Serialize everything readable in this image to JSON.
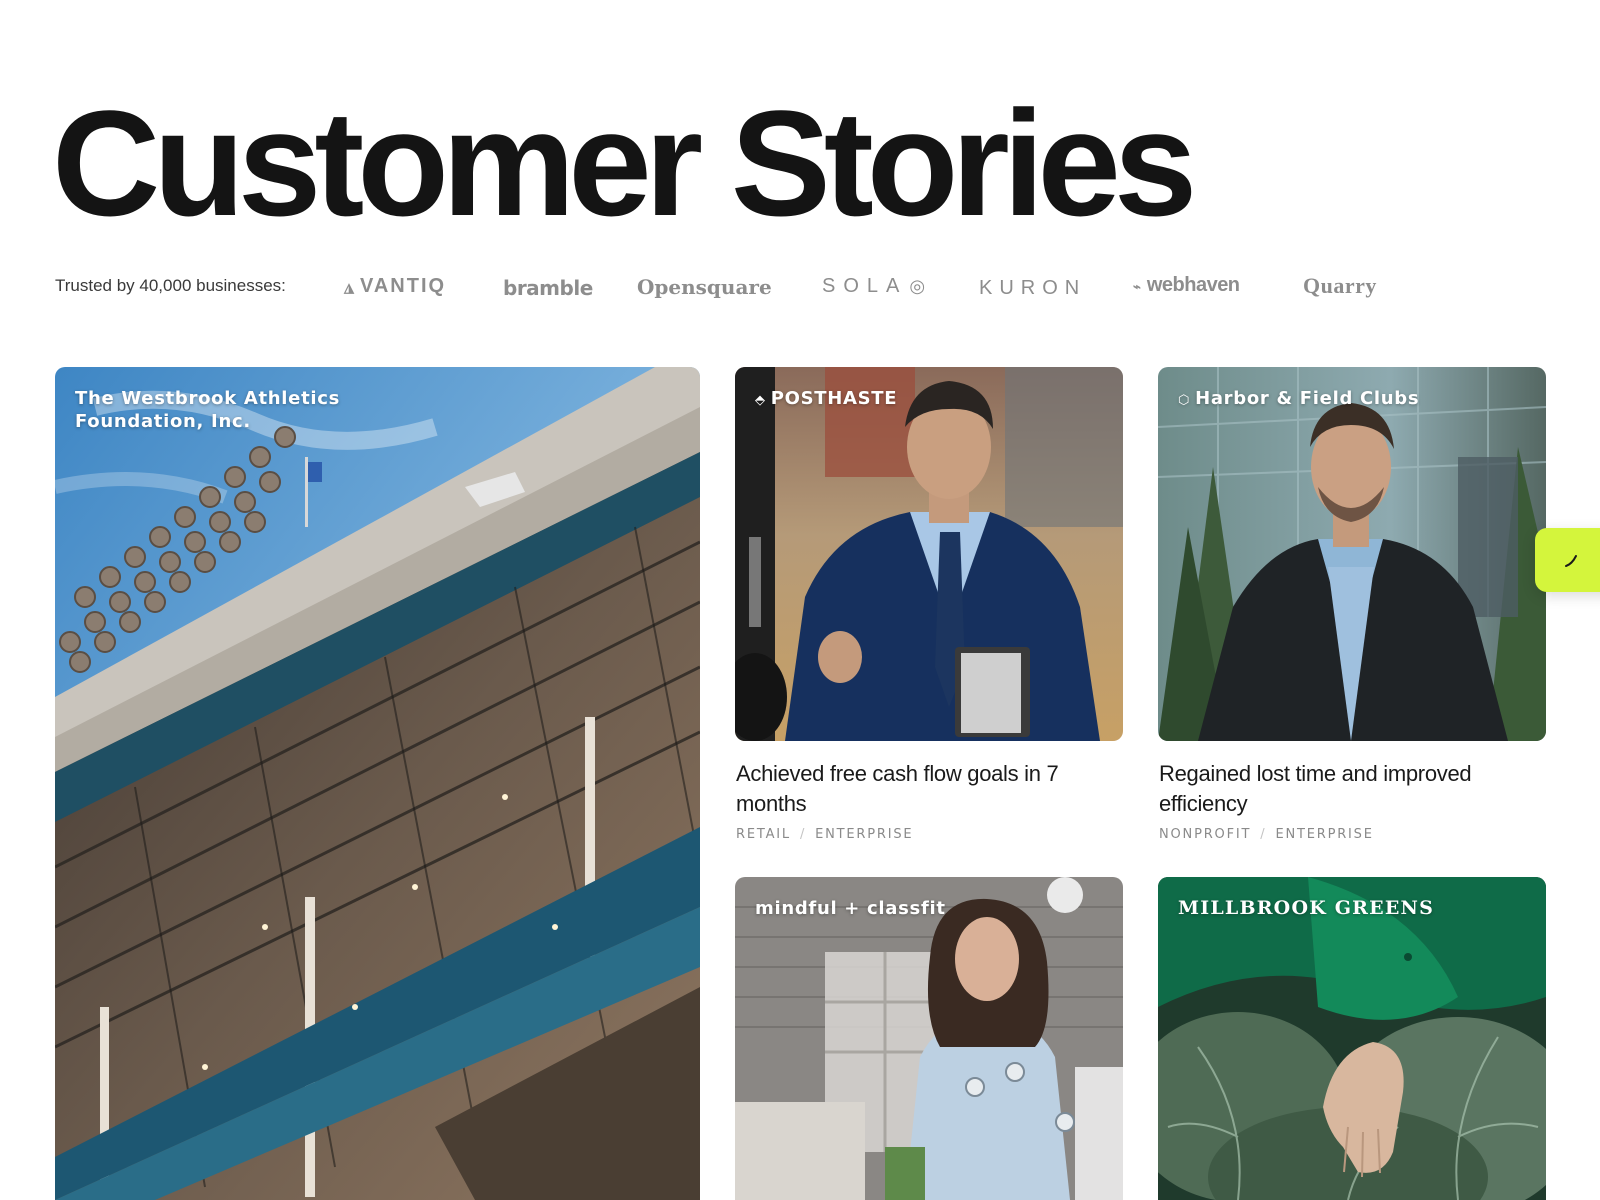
{
  "page": {
    "title": "Customer Stories"
  },
  "trusted": {
    "text": "Trusted by 40,000 businesses:",
    "logos": [
      "VANTIQ",
      "bramble",
      "Opensquare",
      "SOLA",
      "KURON",
      "webhaven",
      "Quarry"
    ]
  },
  "stories": [
    {
      "company": "The Westbrook Athletics Foundation, Inc.",
      "company_line1": "The Westbrook Athletics",
      "company_line2": "Foundation, Inc.",
      "image": "stadium-grandstand-photo"
    },
    {
      "company": "POSTHASTE",
      "image": "man-in-navy-suit-photo",
      "title": "Achieved free cash flow goals in 7 months",
      "industry": "RETAIL",
      "segment": "ENTERPRISE"
    },
    {
      "company": "Harbor & Field Clubs",
      "image": "man-in-blazer-photo",
      "title": "Regained lost time and improved efficiency",
      "industry": "NONPROFIT",
      "segment": "ENTERPRISE"
    },
    {
      "company": "mindful + classfit",
      "image": "woman-in-office-photo"
    },
    {
      "company": "MILLBROOK GREENS",
      "image": "hand-on-cabbage-photo"
    }
  ],
  "colors": {
    "accent": "#d4f53c",
    "text": "#141414",
    "muted": "#8a8a8a"
  },
  "feedback_tab": {
    "icon": "leaf-icon"
  }
}
